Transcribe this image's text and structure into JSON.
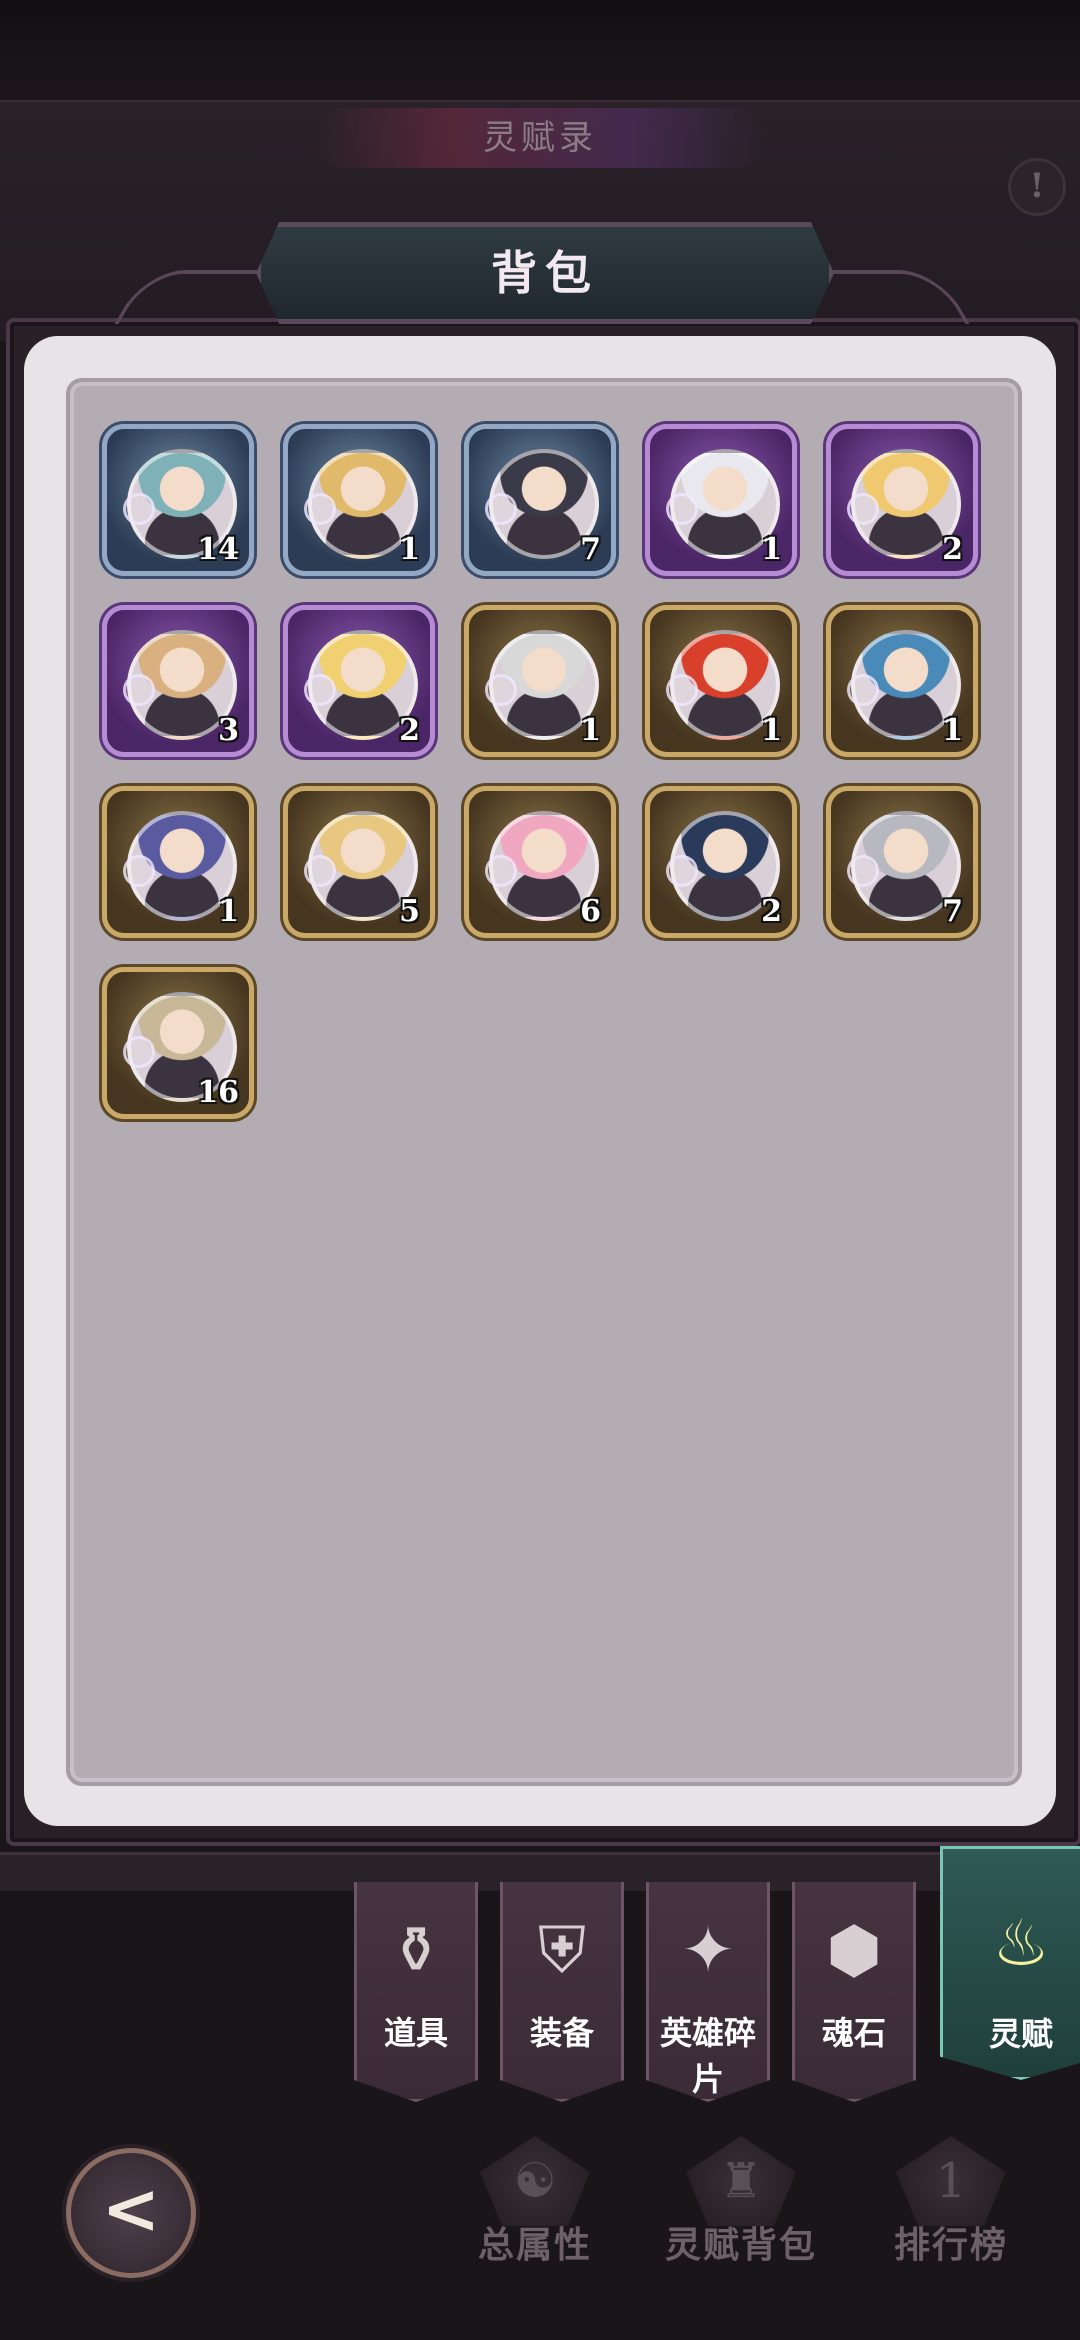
{
  "background": {
    "title": "灵赋录"
  },
  "modal": {
    "title": "背包"
  },
  "items": [
    {
      "rarity": "blue",
      "hair": "#7fb2b8",
      "count": "14"
    },
    {
      "rarity": "blue",
      "hair": "#e0b96a",
      "count": "1"
    },
    {
      "rarity": "blue",
      "hair": "#3a3a48",
      "count": "7"
    },
    {
      "rarity": "purple",
      "hair": "#e8e8ee",
      "count": "1"
    },
    {
      "rarity": "purple",
      "hair": "#f0c870",
      "count": "2"
    },
    {
      "rarity": "purple",
      "hair": "#d9b080",
      "count": "3"
    },
    {
      "rarity": "purple",
      "hair": "#f0d070",
      "count": "2"
    },
    {
      "rarity": "gold",
      "hair": "#d8d8d8",
      "count": "1"
    },
    {
      "rarity": "gold",
      "hair": "#d8402c",
      "count": "1"
    },
    {
      "rarity": "gold",
      "hair": "#4a8ab8",
      "count": "1"
    },
    {
      "rarity": "gold",
      "hair": "#5a5aa0",
      "count": "1"
    },
    {
      "rarity": "gold",
      "hair": "#e8c880",
      "count": "5"
    },
    {
      "rarity": "gold",
      "hair": "#f0a8c0",
      "count": "6"
    },
    {
      "rarity": "gold",
      "hair": "#2a3a5a",
      "count": "2"
    },
    {
      "rarity": "gold",
      "hair": "#b8b8c0",
      "count": "7"
    },
    {
      "rarity": "gold",
      "hair": "#c8b898",
      "count": "16"
    }
  ],
  "tabs": [
    {
      "label": "道具",
      "icon": "item-bag-icon",
      "glyph": "⚱"
    },
    {
      "label": "装备",
      "icon": "armor-icon",
      "glyph": "⛨"
    },
    {
      "label": "英雄碎片",
      "icon": "puzzle-star-icon",
      "glyph": "✦"
    },
    {
      "label": "魂石",
      "icon": "soul-stone-icon",
      "glyph": "⬢"
    },
    {
      "label": "灵赋",
      "icon": "spirit-flame-icon",
      "glyph": "♨",
      "active": true
    }
  ],
  "bottom_nav": [
    {
      "label": "总属性",
      "icon": "attributes-icon",
      "glyph": "☯"
    },
    {
      "label": "灵赋背包",
      "icon": "backpack-icon",
      "glyph": "♜"
    },
    {
      "label": "排行榜",
      "icon": "leaderboard-icon",
      "glyph": "1"
    }
  ],
  "back": {
    "icon": "back-arrow-icon",
    "glyph": "<"
  }
}
